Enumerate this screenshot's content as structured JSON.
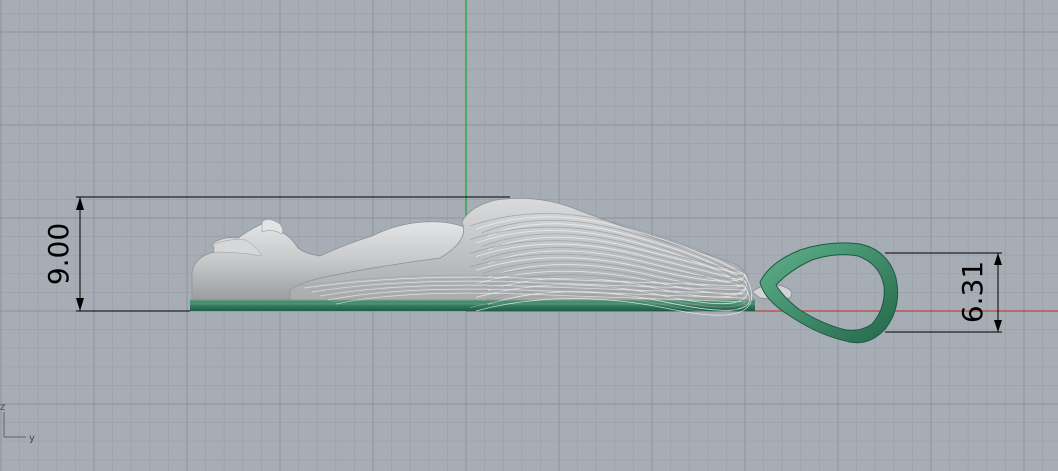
{
  "viewport": {
    "background": "#a7adb5",
    "grid_minor_color": "#99a0a8",
    "grid_major_color": "#8c939c",
    "axis_green": "#2fa84a",
    "axis_red": "#b8473a"
  },
  "dimensions": [
    {
      "name": "total-height",
      "label": "9.00"
    },
    {
      "name": "bail-height",
      "label": "6.31"
    }
  ],
  "axis_labels": {
    "vertical": "z",
    "horizontal": "y"
  },
  "model": {
    "base_color": "#2f7a5c",
    "body_color": "#c8cacc",
    "bail_color": "#3b8f6c"
  }
}
